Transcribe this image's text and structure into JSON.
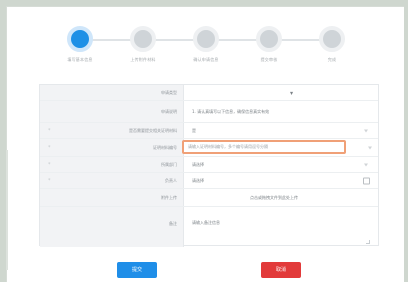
{
  "stepper": {
    "steps": [
      {
        "label": "填写基本信息",
        "active": true
      },
      {
        "label": "上传附件材料",
        "active": false
      },
      {
        "label": "确认申请信息",
        "active": false
      },
      {
        "label": "提交审核",
        "active": false
      },
      {
        "label": "完成",
        "active": false
      }
    ]
  },
  "form": {
    "rows": [
      {
        "label": "申请类型",
        "required": false,
        "value": "▼"
      },
      {
        "label": "申请说明",
        "required": false,
        "value": "1. 请认真填写以下信息，确保信息真实有效"
      },
      {
        "label": "是否需要提交相关证明材料",
        "required": true,
        "value": "是"
      },
      {
        "label": "证明材料编号",
        "required": true,
        "value": "请输入证明材料编号，多个编号请用逗号分隔"
      },
      {
        "label": "所属部门",
        "required": true,
        "value": "请选择"
      },
      {
        "label": "负责人",
        "required": true,
        "value": "请选择"
      },
      {
        "label": "附件上传",
        "required": false,
        "value": "点击或拖拽文件到此处上传"
      },
      {
        "label": "备注",
        "required": false,
        "value": "请输入备注信息"
      }
    ]
  },
  "buttons": {
    "primary_label": "提交",
    "danger_label": "取消"
  },
  "colors": {
    "accent": "#1f8ee8",
    "danger": "#e23a3a",
    "highlight_border": "#f0a077"
  }
}
